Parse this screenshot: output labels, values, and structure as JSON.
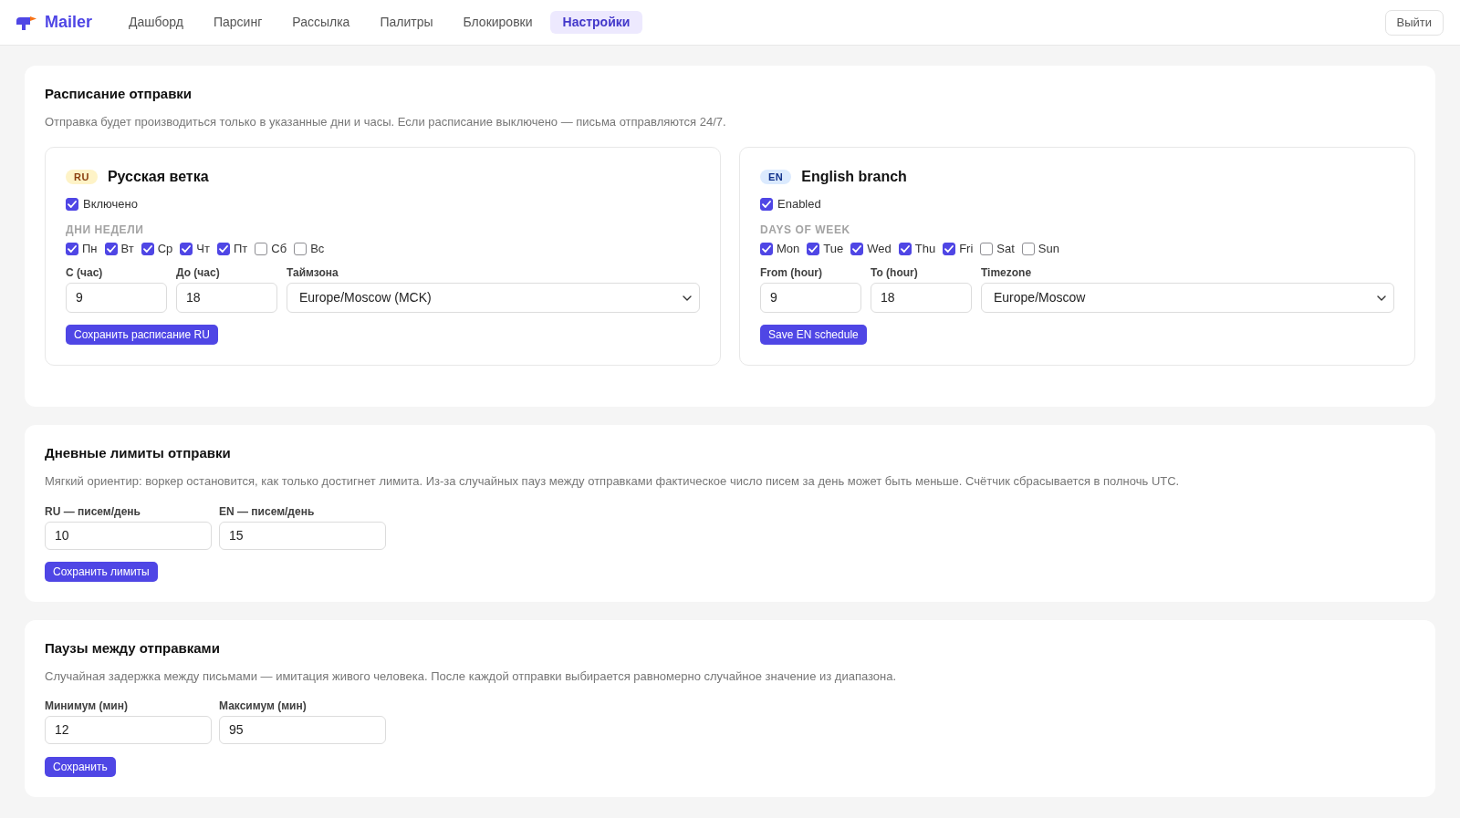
{
  "nav": {
    "logo": "Mailer",
    "items": [
      {
        "label": "Дашборд",
        "selected": false
      },
      {
        "label": "Парсинг",
        "selected": false
      },
      {
        "label": "Рассылка",
        "selected": false
      },
      {
        "label": "Палитры",
        "selected": false
      },
      {
        "label": "Блокировки",
        "selected": false
      },
      {
        "label": "Настройки",
        "selected": true
      }
    ],
    "logout": "Выйти"
  },
  "schedule": {
    "title": "Расписание отправки",
    "description": "Отправка будет производиться только в указанные дни и часы. Если расписание выключено — письма отправляются 24/7.",
    "branches": [
      {
        "badge": {
          "label": "RU",
          "color": "#fef3c7"
        },
        "title": "Русская ветка",
        "enabled": {
          "label": "Включено",
          "checked": true
        },
        "days_label": "ДНИ НЕДЕЛИ",
        "days": [
          {
            "label": "Пн",
            "checked": true
          },
          {
            "label": "Вт",
            "checked": true
          },
          {
            "label": "Ср",
            "checked": true
          },
          {
            "label": "Чт",
            "checked": true
          },
          {
            "label": "Пт",
            "checked": true
          },
          {
            "label": "Сб",
            "checked": false
          },
          {
            "label": "Вс",
            "checked": false
          }
        ],
        "fields": [
          {
            "kind": "input",
            "label": "С (час)",
            "value": "9"
          },
          {
            "kind": "input",
            "label": "До (час)",
            "value": "18"
          },
          {
            "kind": "select",
            "label": "Таймзона",
            "value": "Europe/Moscow (MCK)"
          }
        ],
        "save_button": "Сохранить расписание RU"
      },
      {
        "badge": {
          "label": "EN",
          "color": "#dbeafe"
        },
        "title": "English branch",
        "enabled": {
          "label": "Enabled",
          "checked": true
        },
        "days_label": "DAYS OF WEEK",
        "days": [
          {
            "label": "Mon",
            "checked": true
          },
          {
            "label": "Tue",
            "checked": true
          },
          {
            "label": "Wed",
            "checked": true
          },
          {
            "label": "Thu",
            "checked": true
          },
          {
            "label": "Fri",
            "checked": true
          },
          {
            "label": "Sat",
            "checked": false
          },
          {
            "label": "Sun",
            "checked": false
          }
        ],
        "fields": [
          {
            "kind": "input",
            "label": "From (hour)",
            "value": "9"
          },
          {
            "kind": "input",
            "label": "To (hour)",
            "value": "18"
          },
          {
            "kind": "select",
            "label": "Timezone",
            "value": "Europe/Moscow"
          }
        ],
        "save_button": "Save EN schedule"
      }
    ]
  },
  "limits": {
    "title": "Дневные лимиты отправки",
    "description": "Мягкий ориентир: воркер остановится, как только достигнет лимита. Из-за случайных пауз между отправками фактическое число писем за день может быть меньше. Счётчик сбрасывается в полночь UTC.",
    "fields": [
      {
        "label": "RU — писем/день",
        "value": "10"
      },
      {
        "label": "EN — писем/день",
        "value": "15"
      }
    ],
    "save_button": "Сохранить лимиты"
  },
  "pauses": {
    "title": "Паузы между отправками",
    "description": "Случайная задержка между письмами — имитация живого человека. После каждой отправки выбирается равномерно случайное значение из диапазона.",
    "fields": [
      {
        "label": "Минимум (мин)",
        "value": "12"
      },
      {
        "label": "Максимум (мин)",
        "value": "95"
      }
    ],
    "save_button": "Сохранить"
  }
}
